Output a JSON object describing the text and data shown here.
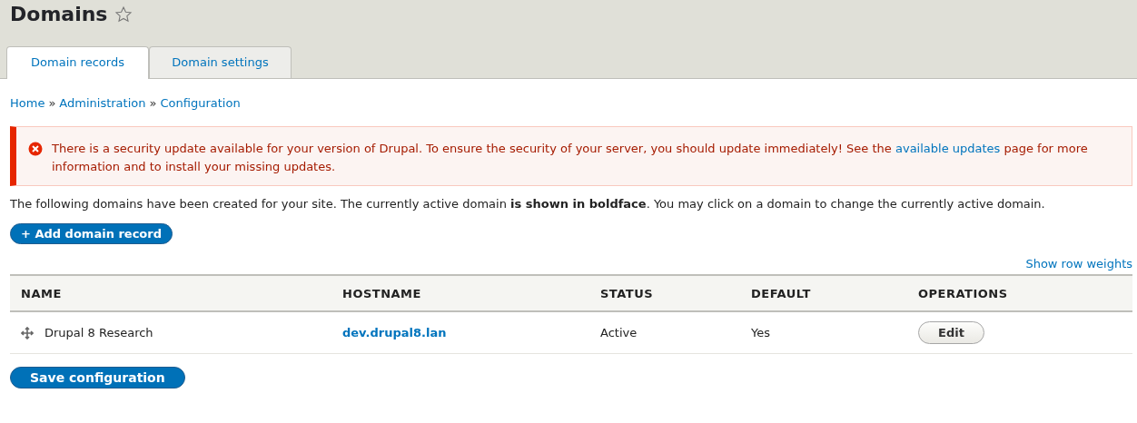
{
  "page_title": "Domains",
  "favorite": false,
  "tabs": [
    {
      "label": "Domain records",
      "selected": true
    },
    {
      "label": "Domain settings",
      "selected": false
    }
  ],
  "breadcrumb": [
    "Home",
    "Administration",
    "Configuration"
  ],
  "breadcrumb_separator": "»",
  "message": {
    "error": true,
    "text_before": "There is a security update available for your version of Drupal. To ensure the security of your server, you should update immediately! See the",
    "link": "available updates",
    "text_after": "page for more information and to install your missing updates."
  },
  "intro": "The following domains have been created for your site. The currently active domain **is shown in boldface**. You may click on a domain to change the currently active domain.",
  "add_button": "+ Add domain record",
  "show_weights": "Show row weights",
  "table": {
    "columns": [
      "NAME",
      "HOSTNAME",
      "STATUS",
      "DEFAULT",
      "OPERATIONS"
    ],
    "rows": [
      {
        "name": "Drupal 8 Research",
        "hostname": "dev.drupal8.lan",
        "status": "Active",
        "default": "Yes",
        "operation": "Edit"
      }
    ]
  },
  "save_button": "Save configuration"
}
